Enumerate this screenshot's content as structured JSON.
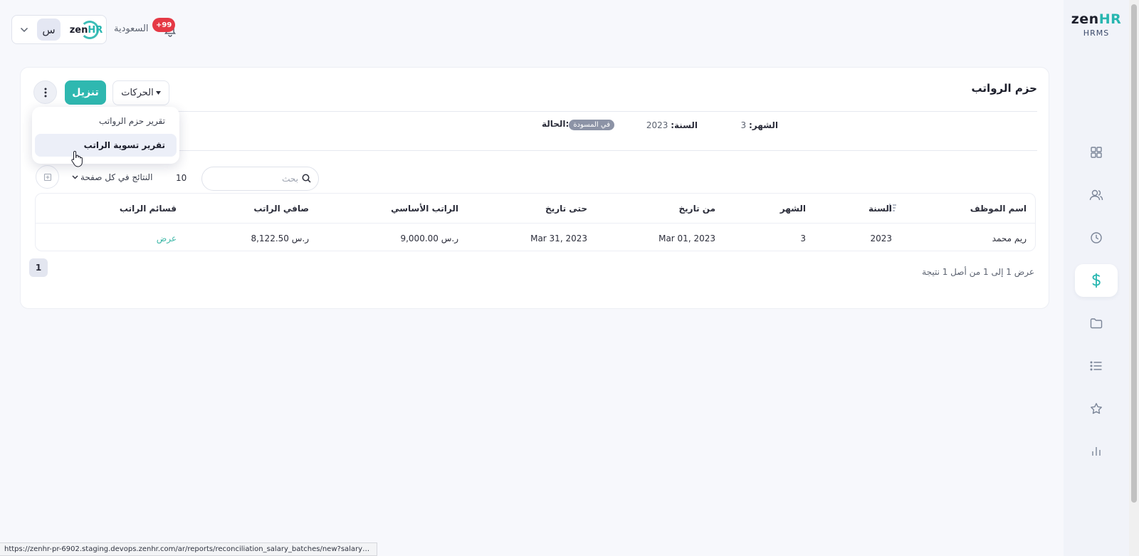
{
  "app": {
    "logo_main": "zen",
    "logo_hr": "HR",
    "logo_sub": "HRMS"
  },
  "topbar": {
    "avatar_letter": "س",
    "company_logo_main": "zen",
    "company_logo_hr": "HR",
    "country": "السعودية",
    "notifications_badge": "+99"
  },
  "page": {
    "title": "حزم الرواتب",
    "actions_label": "الحركات",
    "download_label": "تنزيل"
  },
  "batch_info": {
    "month_label": "الشهر:",
    "month_value": "3",
    "year_label": "السنة:",
    "year_value": "2023",
    "status_label": "الحالة:",
    "status_value": "في المسودة"
  },
  "controls": {
    "search_placeholder": "بحث",
    "per_page_value": "10",
    "per_page_label": "النتائج في كل صفحة"
  },
  "table": {
    "headers": {
      "employee": "اسم الموظف",
      "year": "السنة",
      "month": "الشهر",
      "from_date": "من تاريخ",
      "to_date": "حتى تاريخ",
      "basic_salary": "الراتب الأساسي",
      "net_salary": "صافي الراتب",
      "payslips": "قسائم الراتب"
    },
    "rows": [
      {
        "employee": "ريم محمد",
        "year": "2023",
        "month": "3",
        "from_date": "Mar 01, 2023",
        "to_date": "Mar 31, 2023",
        "basic_salary": "9,000.00 ر.س",
        "net_salary": "8,122.50 ر.س",
        "payslips": "عرض"
      }
    ]
  },
  "pagination": {
    "current_page": "1",
    "summary": "عرض 1 إلى 1 من أصل 1 نتيجة"
  },
  "menu": {
    "items": [
      {
        "label": "تقرير حزم الرواتب"
      },
      {
        "label": "تقرير تسوية الراتب"
      }
    ]
  },
  "statusbar": {
    "url": "https://zenhr-pr-6902.staging.devops.zenhr.com/ar/reports/reconciliation_salary_batches/new?salary_batch_id=1742..."
  },
  "sidebar_nav": [
    {
      "icon": "dashboard-grid-icon"
    },
    {
      "icon": "users-icon"
    },
    {
      "icon": "clock-icon"
    },
    {
      "icon": "dollar-icon"
    },
    {
      "icon": "folder-icon"
    },
    {
      "icon": "list-icon"
    },
    {
      "icon": "star-icon"
    },
    {
      "icon": "bar-chart-icon"
    }
  ],
  "colors": {
    "accent": "#2fb8b0",
    "badge": "#e53945",
    "link": "#3fb8a8",
    "status_pill": "#8c93a6"
  }
}
